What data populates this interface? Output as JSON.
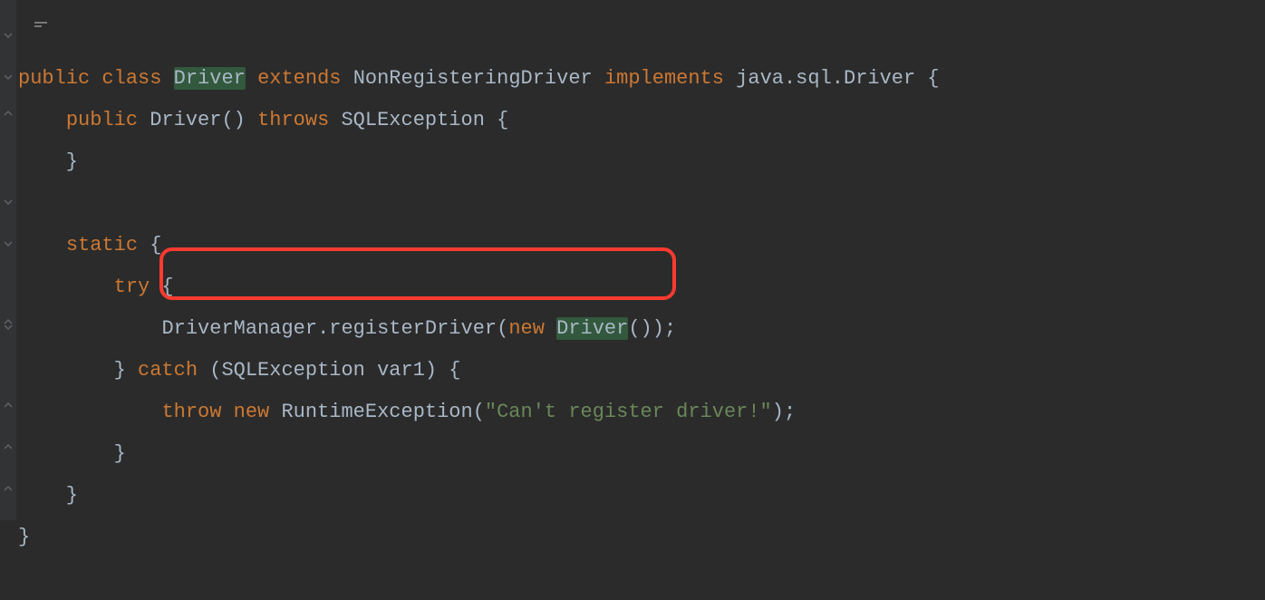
{
  "code": {
    "l1": {
      "kw_public": "public",
      "kw_class": "class",
      "name_driver": "Driver",
      "kw_extends": "extends",
      "name_parent": "NonRegisteringDriver",
      "kw_implements": "implements",
      "name_iface": "java.sql.Driver",
      "brace": " {"
    },
    "l2": {
      "indent": "    ",
      "kw_public": "public",
      "ctor": " Driver() ",
      "kw_throws": "throws",
      "exc": " SQLException {"
    },
    "l3": {
      "text": "    }"
    },
    "l4": {
      "text": ""
    },
    "l5": {
      "indent": "    ",
      "kw_static": "static",
      "brace": " {"
    },
    "l6": {
      "indent": "        ",
      "kw_try": "try",
      "brace": " {"
    },
    "l7": {
      "indent": "            ",
      "prefix": "DriverManager.registerDriver(",
      "kw_new": "new",
      "sp": " ",
      "cls": "Driver",
      "suffix": "());"
    },
    "l8": {
      "indent": "        ",
      "close": "} ",
      "kw_catch": "catch",
      "params": " (SQLException var1) {"
    },
    "l9": {
      "indent": "            ",
      "kw_throw": "throw",
      "sp1": " ",
      "kw_new": "new",
      "sp2": " ",
      "cls": "RuntimeException(",
      "str": "\"Can't register driver!\"",
      "suffix": ");"
    },
    "l10": {
      "text": "        }"
    },
    "l11": {
      "text": "    }"
    },
    "l12": {
      "text": "}"
    }
  }
}
